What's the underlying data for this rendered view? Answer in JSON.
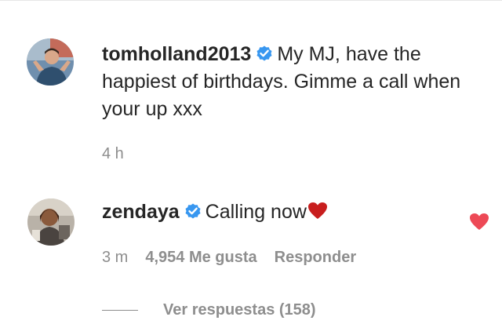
{
  "colors": {
    "text": "#262626",
    "secondary": "#8e8e8e",
    "verified": "#3897f0",
    "heart": "#ed4956"
  },
  "comments": [
    {
      "avatar_icon": "profile-photo-avatar",
      "username": "tomholland2013",
      "verified_icon": "verified-badge-icon",
      "text": "My MJ, have the happiest of birthdays. Gimme a call when your up xxx",
      "time": "4 h"
    },
    {
      "avatar_icon": "profile-photo-avatar",
      "username": "zendaya",
      "verified_icon": "verified-badge-icon",
      "text": "Calling now",
      "emoji_icon": "red-heart-emoji-icon",
      "time": "3 m",
      "likes": "4,954 Me gusta",
      "reply_label": "Responder",
      "like_icon": "heart-filled-icon",
      "view_replies": "Ver respuestas (158)"
    }
  ]
}
